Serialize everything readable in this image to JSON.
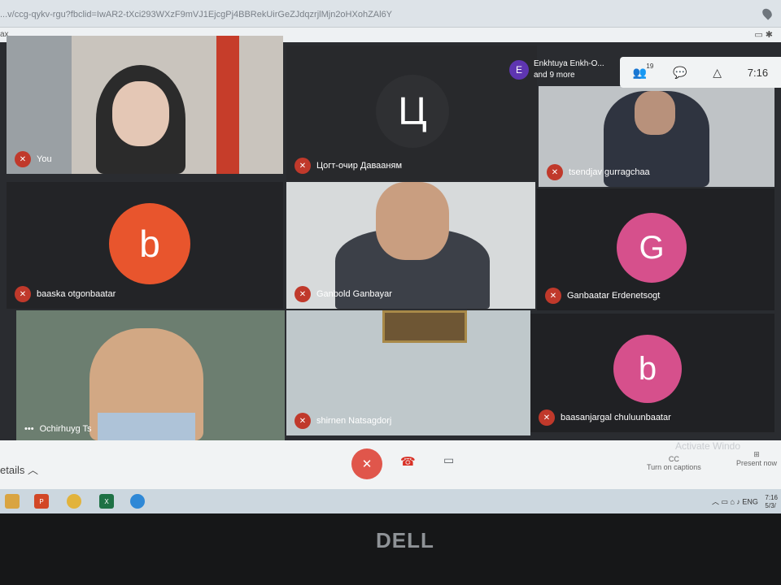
{
  "browser": {
    "url": "...v/ccg-qykv-rgu?fbclid=IwAR2-tXci293WXzF9mVJ1EjcgPj4BBRekUirGeZJdqzrjlMjn2oHXohZAl6Y",
    "tab_fragment": "ax",
    "location_icon": "location-pin-icon"
  },
  "overlay": {
    "host_initial": "E",
    "host_name": "Enkhtuya Enkh-O...",
    "others": "and 9 more",
    "participants_count": "19",
    "time": "7:16"
  },
  "tiles": [
    {
      "name": "You",
      "kind": "video",
      "muted": true
    },
    {
      "name": "Цогт-очир Давааням",
      "kind": "initial",
      "initial": "Ц",
      "avatar_color": "#3a3b3f",
      "muted": true
    },
    {
      "name": "tsendjav gurragchaa",
      "kind": "video",
      "muted": true
    },
    {
      "name": "baaska otgonbaatar",
      "kind": "initial",
      "initial": "b",
      "avatar_color": "#e8552d",
      "muted": true
    },
    {
      "name": "Ganbold Ganbayar",
      "kind": "video",
      "muted": true
    },
    {
      "name": "Ganbaatar Erdenetsogt",
      "kind": "initial",
      "initial": "G",
      "avatar_color": "#d6508c",
      "muted": true
    },
    {
      "name": "Ochirhuyg Ts",
      "kind": "video",
      "muted": false
    },
    {
      "name": "shirnen Natsagdorj",
      "kind": "video",
      "muted": true
    },
    {
      "name": "baasanjargal chuluunbaatar",
      "kind": "initial",
      "initial": "b",
      "avatar_color": "#d6508c",
      "muted": true
    }
  ],
  "bottombar": {
    "details_label": "etails",
    "captions_label": "Turn on captions",
    "present_label": "Present now",
    "watermark": "Activate Windo"
  },
  "taskbar": {
    "lang": "ENG",
    "time": "7:16",
    "date": "5/3/"
  },
  "bezel": {
    "brand": "DELL"
  }
}
